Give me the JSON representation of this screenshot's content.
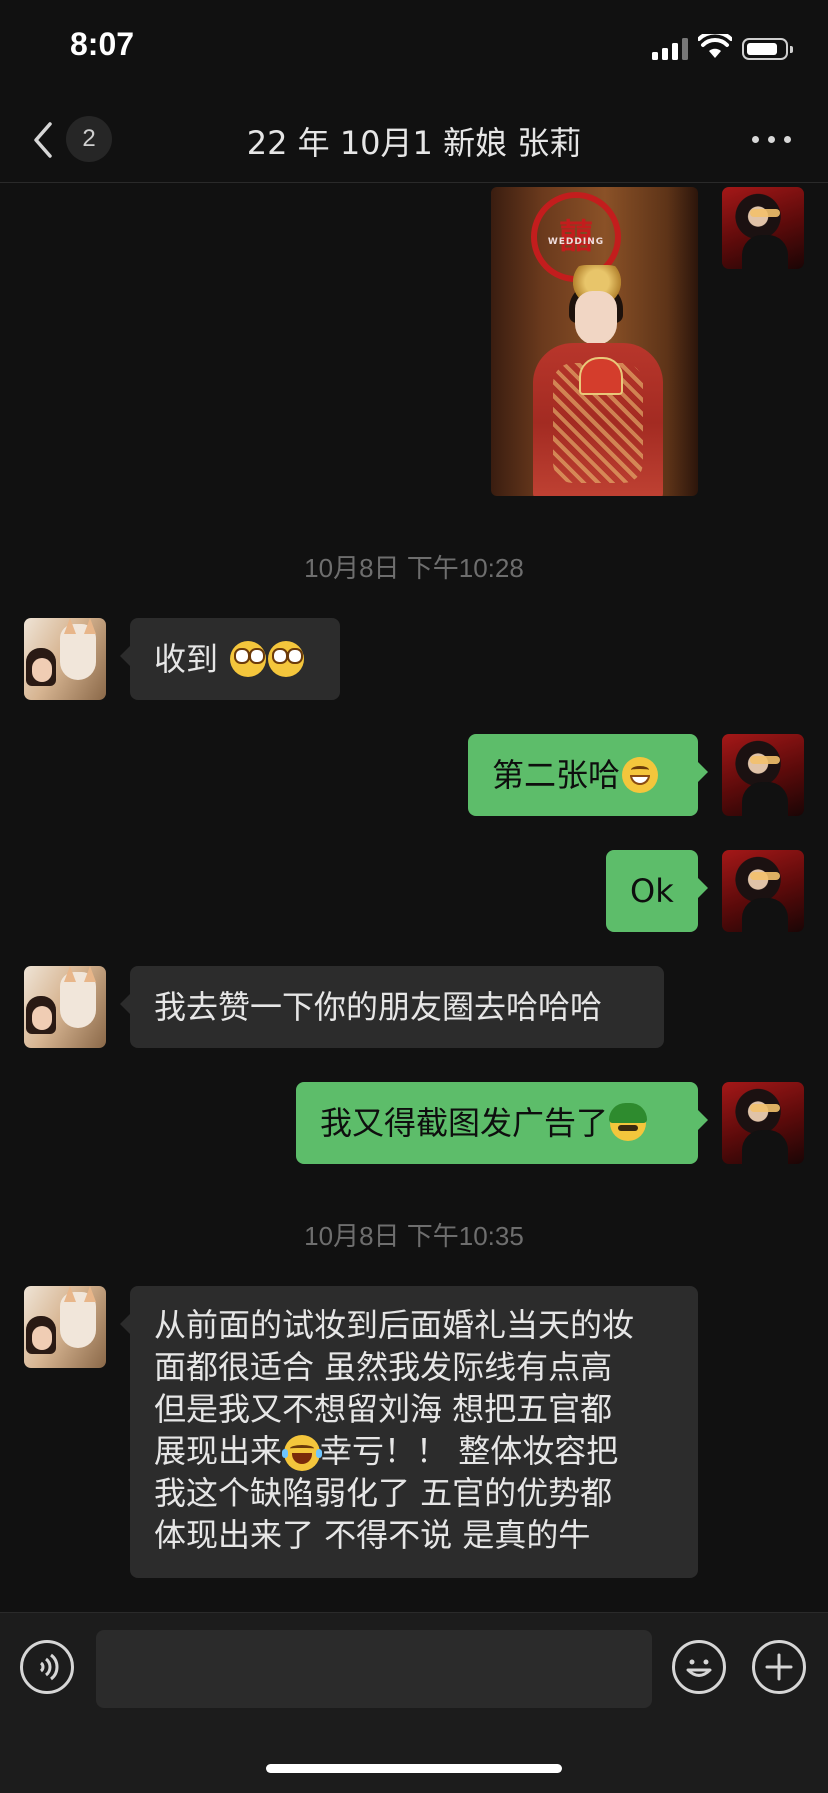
{
  "status_bar": {
    "time": "8:07"
  },
  "header": {
    "unread_badge": "2",
    "title": "22 年 10月1 新娘 张莉"
  },
  "messages": {
    "photo_caption": "WEDDING",
    "photo_symbol": "囍",
    "ts1": "10月8日 下午10:28",
    "m1": "收到",
    "m2": "第二张哈",
    "m3": "Ok",
    "m4": "我去赞一下你的朋友圈去哈哈哈",
    "m5": "我又得截图发广告了",
    "ts2": "10月8日 下午10:35",
    "m6": "从前面的试妆到后面婚礼当天的妆\n面都很适合 虽然我发际线有点高\n但是我又不想留刘海 想把五官都\n展现出来",
    "m6b": "幸亏！！ 整体妆容把\n我这个缺陷弱化了 五官的优势都\n体现出来了  不得不说 是真的牛"
  },
  "input": {
    "value": ""
  },
  "colors": {
    "background": "#111111",
    "out_bubble": "#5dbd6a",
    "in_bubble": "#2c2c2c"
  }
}
